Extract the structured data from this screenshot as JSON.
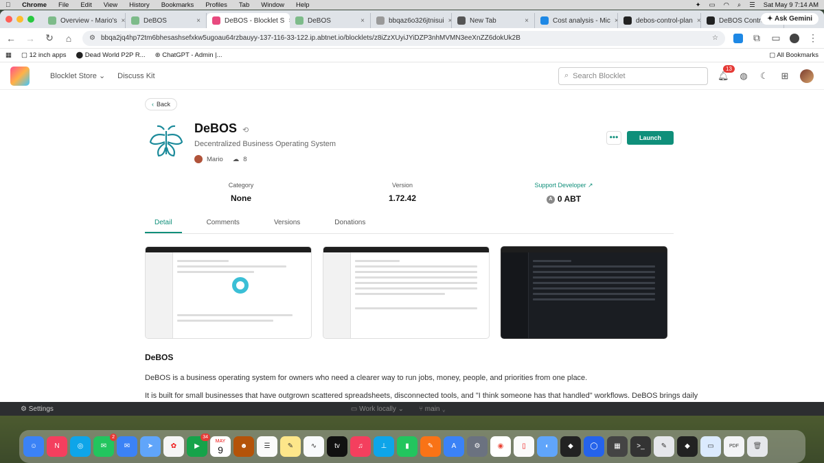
{
  "menubar": {
    "items": [
      "Chrome",
      "File",
      "Edit",
      "View",
      "History",
      "Bookmarks",
      "Profiles",
      "Tab",
      "Window",
      "Help"
    ],
    "clock": "Sat May 9  7:14 AM"
  },
  "tabs": [
    {
      "title": "Overview - Mario's",
      "color": "#7dbb8a"
    },
    {
      "title": "DeBOS",
      "color": "#7dbb8a"
    },
    {
      "title": "DeBOS - Blocklet S",
      "color": "#e84a7f",
      "active": true
    },
    {
      "title": "DeBOS",
      "color": "#7dbb8a"
    },
    {
      "title": "bbqaz6o326jtnisui",
      "color": "#999999"
    },
    {
      "title": "New Tab",
      "color": "#555555"
    },
    {
      "title": "Cost analysis - Mic",
      "color": "#1e88e5"
    },
    {
      "title": "debos-control-plan",
      "color": "#222222"
    },
    {
      "title": "DeBOS Control-Pla",
      "color": "#222222"
    }
  ],
  "gemini_label": "Ask Gemini",
  "url": "bbqa2jq4hp72tm6bhesashsefxkw5ugoau64rzbauyy-137-116-33-122.ip.abtnet.io/blocklets/z8iZzXUyiJYiDZP3nhMVMN3eeXnZZ6dokUk2B",
  "bookmarks": [
    "12 inch apps",
    "Dead World P2P R...",
    "ChatGPT - Admin |..."
  ],
  "all_bookmarks": "All Bookmarks",
  "site": {
    "nav": [
      "Blocklet Store",
      "Discuss Kit"
    ],
    "search_placeholder": "Search Blocklet",
    "notif_count": "13"
  },
  "back_label": "Back",
  "app": {
    "name": "DeBOS",
    "subtitle": "Decentralized Business Operating System",
    "author": "Mario",
    "installs": "8",
    "launch_label": "Launch",
    "more_label": "•••"
  },
  "stats": [
    {
      "label": "Category",
      "value": "None"
    },
    {
      "label": "Version",
      "value": "1.72.42"
    },
    {
      "label": "Support Developer ↗",
      "value": "0 ABT"
    }
  ],
  "content_tabs": [
    "Detail",
    "Comments",
    "Versions",
    "Donations"
  ],
  "description": {
    "heading": "DeBOS",
    "p1": "DeBOS is a business operating system for owners who need a clearer way to run jobs, money, people, and priorities from one place.",
    "p2": "It is built for small businesses that have outgrown scattered spreadsheets, disconnected tools, and \"I think someone has that handled\" workflows. DeBOS brings daily"
  },
  "below_window": {
    "settings": "Settings",
    "work": "Work locally",
    "branch": "main"
  },
  "dock": {
    "calendar_month": "MAY",
    "calendar_day": "9",
    "messages_badge": "2",
    "facetime_badge": "34"
  }
}
